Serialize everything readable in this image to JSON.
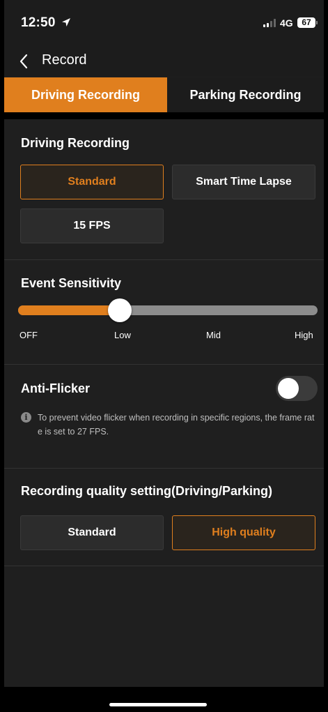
{
  "status_bar": {
    "time": "12:50",
    "network": "4G",
    "battery": "67"
  },
  "nav": {
    "title": "Record"
  },
  "tabs": [
    {
      "label": "Driving Recording",
      "active": true
    },
    {
      "label": "Parking Recording",
      "active": false
    }
  ],
  "driving_recording": {
    "title": "Driving Recording",
    "options": [
      {
        "label": "Standard",
        "selected": true
      },
      {
        "label": "Smart Time Lapse",
        "selected": false
      },
      {
        "label": "15 FPS",
        "selected": false
      }
    ]
  },
  "event_sensitivity": {
    "title": "Event Sensitivity",
    "levels": [
      "OFF",
      "Low",
      "Mid",
      "High"
    ],
    "selected_level": "Low",
    "value_fraction": 0.34
  },
  "anti_flicker": {
    "title": "Anti-Flicker",
    "enabled": false,
    "info": "To prevent video flicker when recording in specific regions, the frame rate is set to 27 FPS."
  },
  "quality": {
    "title": "Recording quality setting(Driving/Parking)",
    "options": [
      {
        "label": "Standard",
        "selected": false
      },
      {
        "label": "High quality",
        "selected": true
      }
    ]
  },
  "colors": {
    "accent": "#e07f1e",
    "background": "#1f1f1f"
  }
}
